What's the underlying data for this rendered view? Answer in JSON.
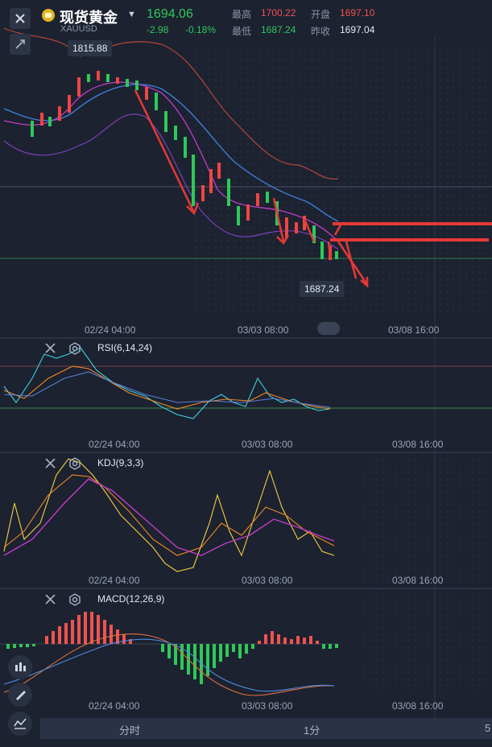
{
  "header": {
    "title": "现货黄金",
    "symbol": "XAUUSD",
    "price": "1694.06",
    "change": "-2.98",
    "change_pct": "-0.18%",
    "stats": {
      "high_label": "最高",
      "high": "1700.22",
      "open_label": "开盘",
      "open": "1697.10",
      "low_label": "最低",
      "low": "1687.24",
      "prev_label": "昨收",
      "prev": "1697.04"
    }
  },
  "main_chart": {
    "high_tag": "1815.88",
    "low_tag": "1687.24",
    "x_ticks": [
      "02/24 04:00",
      "03/03 08:00",
      "03/08 16:00"
    ]
  },
  "panes": {
    "rsi_label": "RSI(6,14,24)",
    "kdj_label": "KDJ(9,3,3)",
    "macd_label": "MACD(12,26,9)"
  },
  "bottom_bar": {
    "left": "分时",
    "mid": "1分",
    "right": "5"
  },
  "colors": {
    "up": "#ef4444",
    "down": "#2ec95a",
    "accent": "#e6b422"
  }
}
